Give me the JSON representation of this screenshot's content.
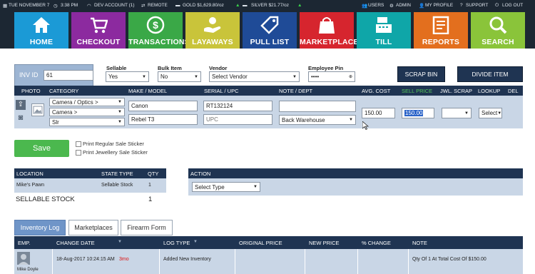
{
  "topbar": {
    "date": "TUE NOVEMBER 7",
    "time": "3:38 PM",
    "account": "DEV ACCOUNT (1)",
    "remote": "REMOTE",
    "gold": "GOLD $1,629.80/oz",
    "silver": "SILVER $21.77/oz",
    "users": "USERS",
    "admin": "ADMIN",
    "my_profile": "MY PROFILE",
    "support": "SUPPORT",
    "logout": "LOG OUT"
  },
  "nav": [
    {
      "label": "HOME",
      "color": "#1b9ad6",
      "icon": "home-icon"
    },
    {
      "label": "CHECKOUT",
      "color": "#8c2a9f",
      "icon": "cart-icon"
    },
    {
      "label": "TRANSACTIONS",
      "color": "#3aa847",
      "icon": "money-icon"
    },
    {
      "label": "LAYAWAYS",
      "color": "#c9c43a",
      "icon": "hand-coin-icon"
    },
    {
      "label": "PULL LIST",
      "color": "#1f4b97",
      "icon": "tag-icon"
    },
    {
      "label": "MARKETPLACE",
      "color": "#d6252e",
      "icon": "bag-icon"
    },
    {
      "label": "TILL",
      "color": "#0fa6a8",
      "icon": "register-icon"
    },
    {
      "label": "REPORTS",
      "color": "#e36f1e",
      "icon": "report-icon"
    },
    {
      "label": "SEARCH",
      "color": "#8ac43a",
      "icon": "search-icon"
    }
  ],
  "form": {
    "inv_id_label": "INV ID",
    "inv_id_value": "61",
    "sellable_label": "Sellable",
    "sellable_value": "Yes",
    "bulk_label": "Bulk Item",
    "bulk_value": "No",
    "vendor_label": "Vendor",
    "vendor_value": "Select Vendor",
    "pin_label": "Employee Pin",
    "pin_value": "••••",
    "scrap_bin": "SCRAP BIN",
    "divide_item": "DIVIDE ITEM"
  },
  "item_headers": [
    "PHOTO",
    "CATEGORY",
    "MAKE / MODEL",
    "SERIAL / UPC",
    "NOTE / DEPT",
    "AVG. COST",
    "SELL PRICE",
    "JWL. SCRAP",
    "LOOKUP",
    "DEL"
  ],
  "item": {
    "category1": "Camera / Optics >",
    "category2": "Camera >",
    "category3": "Slr",
    "make": "Canon",
    "model": "Rebel T3",
    "serial": "RT132124",
    "upc_placeholder": "UPC",
    "note": "",
    "dept": "Back Warehouse",
    "avg_cost": "150.00",
    "sell_price": "150.00",
    "jwl_scrap": "",
    "lookup": "Select"
  },
  "save": {
    "label": "Save",
    "print_regular": "Print Regular Sale Sticker",
    "print_jewellery": "Print Jewellery Sale Sticker"
  },
  "location_table": {
    "headers": [
      "LOCATION",
      "STATE TYPE",
      "QTY"
    ],
    "row": [
      "Mike's Pawn",
      "Sellable Stock",
      "1"
    ],
    "summary_label": "SELLABLE STOCK",
    "summary_qty": "1"
  },
  "action": {
    "header": "ACTION",
    "select": "Select Type"
  },
  "tabs": [
    "Inventory Log",
    "Marketplaces",
    "Firearm Form"
  ],
  "log_table": {
    "headers": [
      "EMP.",
      "CHANGE DATE",
      "LOG TYPE",
      "ORIGINAL PRICE",
      "NEW PRICE",
      "% CHANGE",
      "NOTE"
    ],
    "row": {
      "emp": "Mike Doyle",
      "date": "18-Aug-2017 10:24:15 AM",
      "ago": "3mo",
      "log_type": "Added New Inventory",
      "original_price": "",
      "new_price": "",
      "change": "",
      "note": "Qty Of 1 At Total Cost Of $150.00"
    }
  }
}
